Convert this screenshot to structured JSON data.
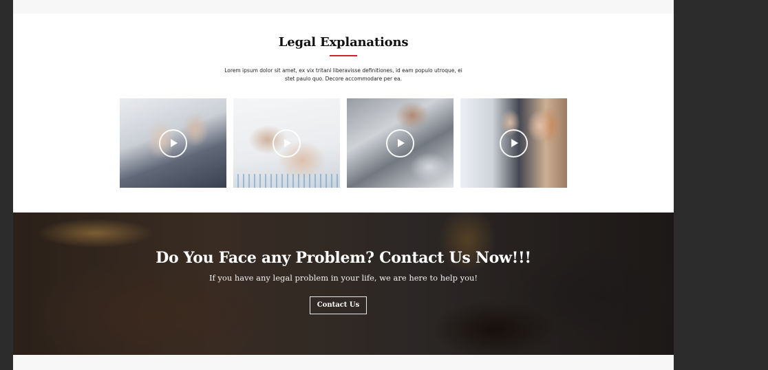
{
  "legal": {
    "title": "Legal Explanations",
    "description": "Lorem ipsum dolor sit amet, ex vix tritani liberavisse definitiones, id eam populo utroque, ei stet paulo quo. Decore accommodare per ea.",
    "videos": [
      {
        "icon": "play-icon"
      },
      {
        "icon": "play-icon"
      },
      {
        "icon": "play-icon"
      },
      {
        "icon": "play-icon"
      }
    ],
    "accent_color": "#d0202e"
  },
  "cta": {
    "heading": "Do You Face any Problem? Contact Us Now!!!",
    "subtext": "If you have any legal problem in your life, we are here to help you!",
    "button_label": "Contact Us"
  }
}
